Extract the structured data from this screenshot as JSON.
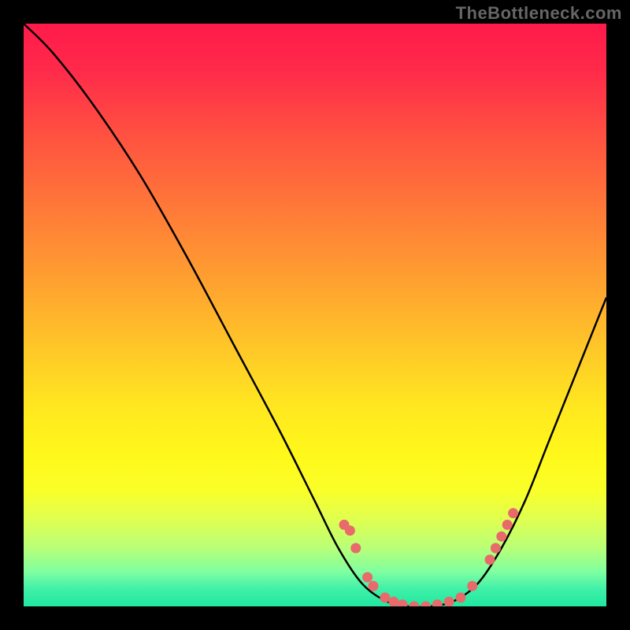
{
  "watermark": "TheBottleneck.com",
  "chart_data": {
    "type": "line",
    "title": "",
    "xlabel": "",
    "ylabel": "",
    "xlim": [
      0,
      100
    ],
    "ylim": [
      0,
      100
    ],
    "curve": [
      {
        "x": 0,
        "y": 100
      },
      {
        "x": 5,
        "y": 95
      },
      {
        "x": 12,
        "y": 86
      },
      {
        "x": 20,
        "y": 74
      },
      {
        "x": 28,
        "y": 60
      },
      {
        "x": 36,
        "y": 45
      },
      {
        "x": 44,
        "y": 30
      },
      {
        "x": 50,
        "y": 18
      },
      {
        "x": 54,
        "y": 10
      },
      {
        "x": 58,
        "y": 4
      },
      {
        "x": 62,
        "y": 1
      },
      {
        "x": 66,
        "y": 0
      },
      {
        "x": 70,
        "y": 0
      },
      {
        "x": 74,
        "y": 1
      },
      {
        "x": 78,
        "y": 4
      },
      {
        "x": 82,
        "y": 10
      },
      {
        "x": 86,
        "y": 18
      },
      {
        "x": 90,
        "y": 28
      },
      {
        "x": 94,
        "y": 38
      },
      {
        "x": 98,
        "y": 48
      },
      {
        "x": 100,
        "y": 53
      }
    ],
    "dots": [
      {
        "x": 55,
        "y": 14
      },
      {
        "x": 56,
        "y": 13
      },
      {
        "x": 57,
        "y": 10
      },
      {
        "x": 59,
        "y": 5
      },
      {
        "x": 60,
        "y": 3.5
      },
      {
        "x": 62,
        "y": 1.5
      },
      {
        "x": 63.5,
        "y": 0.8
      },
      {
        "x": 65,
        "y": 0.3
      },
      {
        "x": 67,
        "y": 0
      },
      {
        "x": 69,
        "y": 0
      },
      {
        "x": 71,
        "y": 0.3
      },
      {
        "x": 73,
        "y": 0.8
      },
      {
        "x": 75,
        "y": 1.5
      },
      {
        "x": 77,
        "y": 3.5
      },
      {
        "x": 80,
        "y": 8
      },
      {
        "x": 81,
        "y": 10
      },
      {
        "x": 82,
        "y": 12
      },
      {
        "x": 83,
        "y": 14
      },
      {
        "x": 84,
        "y": 16
      }
    ],
    "gradient_stops": [
      {
        "pos": 0,
        "color": "#ff1a4a"
      },
      {
        "pos": 50,
        "color": "#ffc828"
      },
      {
        "pos": 75,
        "color": "#fff81a"
      },
      {
        "pos": 100,
        "color": "#20e8a0"
      }
    ]
  }
}
